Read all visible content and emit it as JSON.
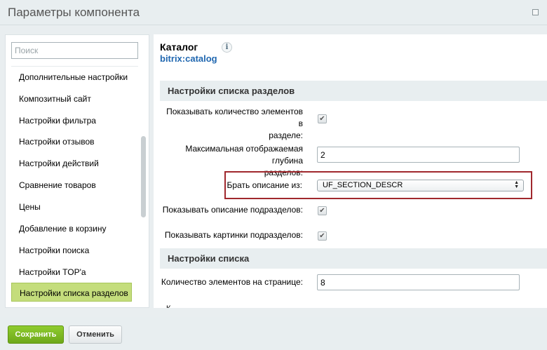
{
  "window": {
    "title": "Параметры компонента"
  },
  "sidebar": {
    "search_placeholder": "Поиск",
    "items": [
      {
        "label": "Дополнительные настройки"
      },
      {
        "label": "Композитный сайт"
      },
      {
        "label": "Настройки фильтра"
      },
      {
        "label": "Настройки отзывов"
      },
      {
        "label": "Настройки действий"
      },
      {
        "label": "Сравнение товаров"
      },
      {
        "label": "Цены"
      },
      {
        "label": "Добавление в корзину"
      },
      {
        "label": "Настройки поиска"
      },
      {
        "label": "Настройки TOP'а"
      },
      {
        "label": "Настройки списка разделов",
        "active": true
      }
    ]
  },
  "component": {
    "name": "Каталог",
    "code": "bitrix:catalog",
    "info_glyph": "i"
  },
  "sections": [
    {
      "title": "Настройки списка разделов",
      "fields": [
        {
          "label_line1": "Показывать количество элементов в",
          "label_line2": "разделе:",
          "type": "checkbox",
          "checked": true
        },
        {
          "label_line1": "Максимальная отображаемая глубина",
          "label_line2": "разделов:",
          "type": "text",
          "value": "2"
        },
        {
          "label": "Брать описание из:",
          "type": "select",
          "value": "UF_SECTION_DESCR",
          "highlighted": true
        },
        {
          "label": "Показывать описание подразделов:",
          "type": "checkbox",
          "checked": true
        },
        {
          "label": "Показывать картинки подразделов:",
          "type": "checkbox",
          "checked": true
        }
      ]
    },
    {
      "title": "Настройки списка",
      "fields": [
        {
          "label": "Количество элементов на странице:",
          "type": "text",
          "value": "8"
        }
      ]
    }
  ],
  "cut_off_text": "К",
  "footer": {
    "save_label": "Сохранить",
    "cancel_label": "Отменить"
  },
  "colors": {
    "accent_green": "#7ab523",
    "link_blue": "#2067b0",
    "highlight_red": "#a0282d",
    "active_item": "#c4dd7c"
  }
}
